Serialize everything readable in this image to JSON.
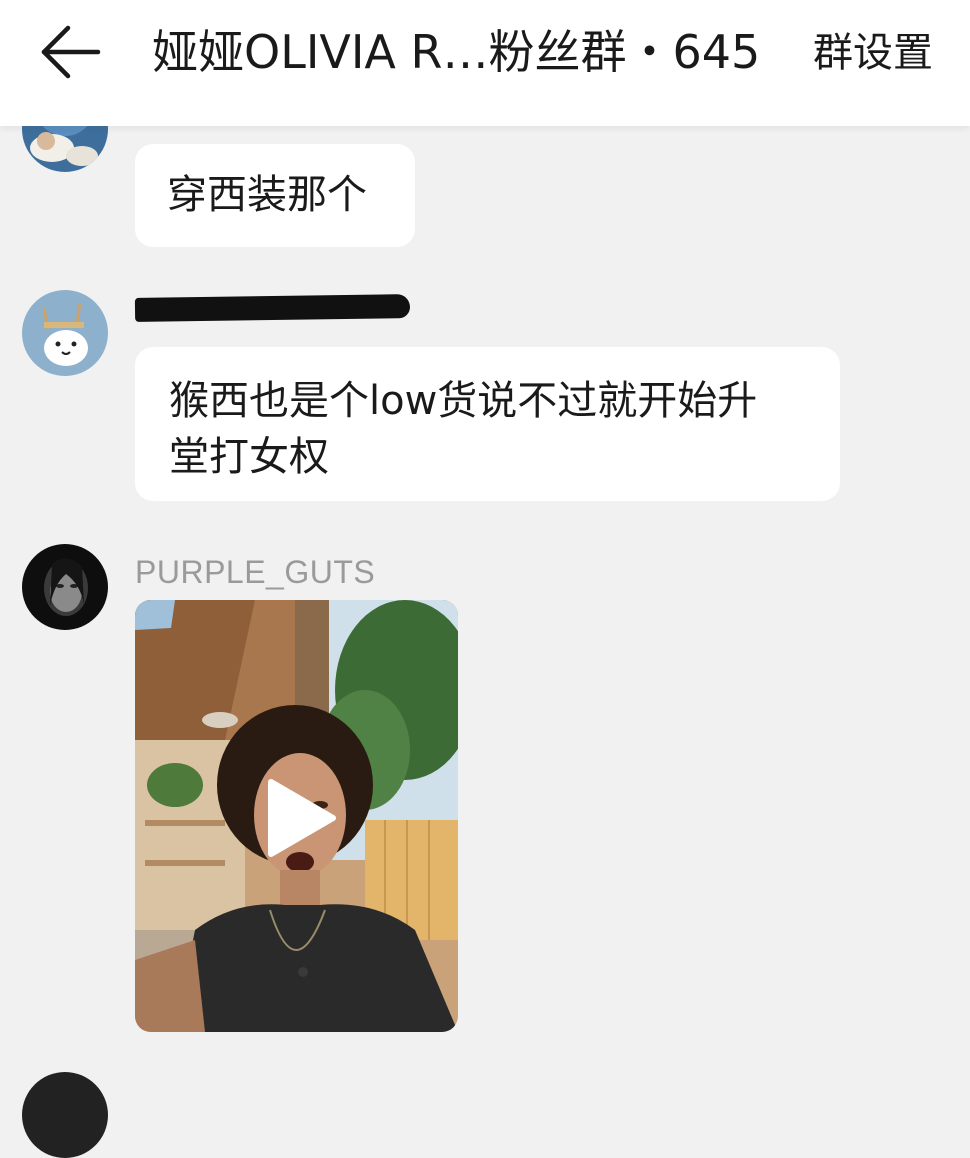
{
  "header": {
    "title": "娅娅OLIVIA R…粉丝群・645",
    "settings_label": "群设置"
  },
  "messages": [
    {
      "sender": "",
      "text": "穿西装那个"
    },
    {
      "sender": "",
      "text_line1": "猴西也是个low货说不过就开始升",
      "text_line2": "堂打女权"
    },
    {
      "sender": "PURPLE_GUTS",
      "type": "video"
    }
  ],
  "colors": {
    "background": "#f1f1f1",
    "bubble": "#ffffff",
    "header": "#ffffff",
    "sender_name": "#9a9a9a"
  }
}
